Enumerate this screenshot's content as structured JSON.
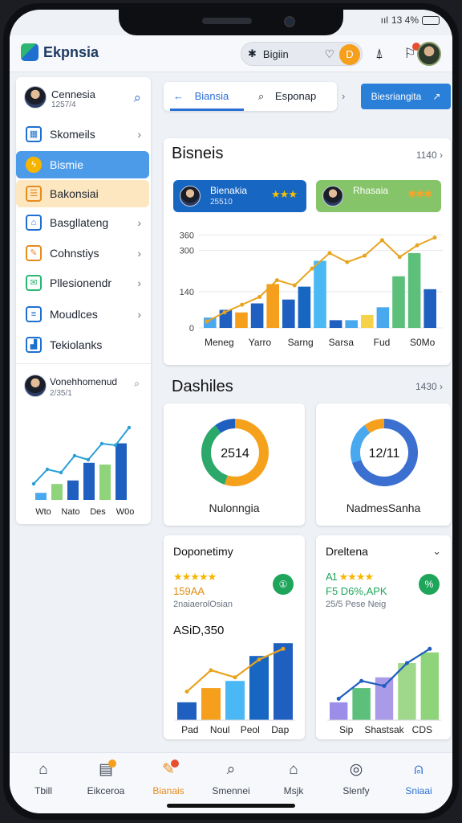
{
  "status": {
    "signal": "ııl",
    "time": "13 4%"
  },
  "app": {
    "name": "Ekpnsia"
  },
  "header": {
    "search_text": "Bigiin",
    "avatar_letter": "D",
    "search_prefix": "✱"
  },
  "sidebar": {
    "profile": {
      "name": "Cennesia",
      "sub": "1257/4"
    },
    "items": [
      {
        "label": "Skomeils",
        "icon": "calendar-icon"
      },
      {
        "label": "Bismie",
        "icon": "bolt-icon"
      },
      {
        "label": "Bakonsiai",
        "icon": "grid-icon"
      },
      {
        "label": "Basgllateng",
        "icon": "shop-icon"
      },
      {
        "label": "Cohnstiys",
        "icon": "edit-icon"
      },
      {
        "label": "Pllesionendr",
        "icon": "mail-icon"
      },
      {
        "label": "Moudlces",
        "icon": "list-icon"
      },
      {
        "label": "Tekiolanks",
        "icon": "chart-icon"
      }
    ],
    "card": {
      "name": "Vonehhomenud",
      "sub": "2/35/1"
    },
    "chart_labels": [
      "Wto",
      "Nato",
      "Des",
      "W0o"
    ]
  },
  "tabs": {
    "back": "Biansia",
    "search": "Esponap",
    "chevron": "›",
    "button": "Biesriangita"
  },
  "business": {
    "title": "Bisneis",
    "meta": "1140",
    "pill_a": {
      "name": "Bienakia",
      "sub": "25510"
    },
    "pill_b": {
      "name": "Rhasaia",
      "sub": ""
    },
    "y_ticks": [
      "360",
      "300",
      "140",
      "0"
    ],
    "x_labels": [
      "Meneg",
      "Yarro",
      "Sarng",
      "Sarsa",
      "Fud",
      "S0Mo"
    ]
  },
  "dashboards": {
    "title": "Dashiles",
    "meta": "1430",
    "donut_a": {
      "center": "2514",
      "label": "Nulonngia"
    },
    "donut_b": {
      "center": "12/11",
      "label": "NadmesSanha"
    }
  },
  "card_left": {
    "title": "Doponetimy",
    "stars": "★★★★★",
    "metric": "159AA",
    "minor": "2naiaerolOsian",
    "value": "ASiD,350",
    "badge": "①",
    "x_labels": [
      "Pad",
      "Noul",
      "Peol",
      "Dap"
    ]
  },
  "card_right": {
    "title": "Dreltena",
    "rating_text": "A1",
    "stars": "★★★★",
    "metric": "F5 D6%,APK",
    "minor": "25/5 Pese Neig",
    "badge": "%",
    "x_labels": [
      "Sip",
      "Shastsak",
      "CDS"
    ]
  },
  "bottom_nav": [
    {
      "label": "Tbill",
      "icon": "home-icon"
    },
    {
      "label": "Eikceroa",
      "icon": "doc-icon"
    },
    {
      "label": "Bianais",
      "icon": "edit-icon"
    },
    {
      "label": "Smennei",
      "icon": "search-icon"
    },
    {
      "label": "Msjk",
      "icon": "building-icon"
    },
    {
      "label": "Slenfy",
      "icon": "compass-icon"
    },
    {
      "label": "Sniaai",
      "icon": "user-icon"
    }
  ],
  "chart_data": [
    {
      "type": "bar",
      "title": "Bisneis",
      "categories": [
        "Meneg",
        "Yarro",
        "Sarng",
        "Sarsa",
        "Fud",
        "S0Mo"
      ],
      "ylim": [
        0,
        380
      ],
      "y_ticks": [
        0,
        140,
        300,
        360
      ],
      "series": [
        {
          "values": [
            40,
            70,
            60,
            95,
            170,
            110,
            160,
            260,
            30,
            30,
            50,
            80,
            200,
            290,
            150
          ]
        },
        {
          "values": [
            25,
            60,
            90,
            120,
            185,
            165,
            230,
            290,
            255,
            280,
            340,
            275,
            320,
            350
          ]
        }
      ]
    },
    {
      "type": "pie",
      "title": "",
      "values": [
        55,
        35,
        10
      ],
      "center_label": "2514"
    },
    {
      "type": "pie",
      "title": "",
      "values": [
        70,
        20,
        10
      ],
      "center_label": "12/11"
    },
    {
      "type": "bar",
      "categories": [
        "Pad",
        "Noul",
        "Peol",
        "Dap"
      ],
      "series": [
        {
          "values": [
            25,
            45,
            55,
            90,
            108
          ]
        },
        {
          "values": [
            40,
            70,
            60,
            85,
            100
          ]
        }
      ]
    },
    {
      "type": "bar",
      "categories": [
        "Sip",
        "Shastsak",
        "CDS"
      ],
      "series": [
        {
          "values": [
            25,
            45,
            60,
            80,
            95
          ]
        },
        {
          "values": [
            30,
            55,
            48,
            80,
            100
          ]
        }
      ]
    }
  ]
}
